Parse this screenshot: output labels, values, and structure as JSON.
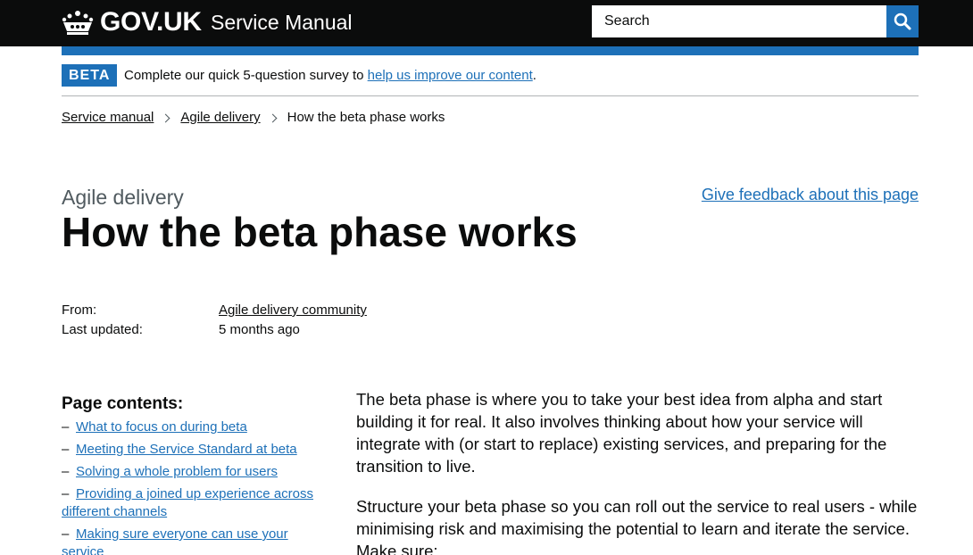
{
  "header": {
    "logo_text": "GOV.UK",
    "service_name": "Service Manual",
    "search_placeholder": "Search",
    "colors": {
      "header_bg": "#0b0c0c",
      "accent_blue": "#1d70b8"
    }
  },
  "phase_banner": {
    "tag": "BETA",
    "text_before": "Complete our quick 5-question survey to ",
    "link_text": "help us improve our content",
    "text_after": "."
  },
  "breadcrumbs": [
    {
      "label": "Service manual"
    },
    {
      "label": "Agile delivery"
    },
    {
      "label": "How the beta phase works"
    }
  ],
  "page": {
    "caption": "Agile delivery",
    "title": "How the beta phase works",
    "feedback_link": "Give feedback about this page"
  },
  "metadata": {
    "from_label": "From:",
    "from_value": "Agile delivery community",
    "updated_label": "Last updated:",
    "updated_value": "5 months ago"
  },
  "contents": {
    "heading": "Page contents:",
    "items": [
      "What to focus on during beta",
      "Meeting the Service Standard at beta",
      "Solving a whole problem for users",
      "Providing a joined up experience across different channels",
      "Making sure everyone can use your service"
    ]
  },
  "body": {
    "paragraphs": [
      "The beta phase is where you to take your best idea from alpha and start building it for real. It also involves thinking about how your service will integrate with (or start to replace) existing services, and preparing for the transition to live.",
      "Structure your beta phase so you can roll out the service to real users - while minimising risk and maximising the potential to learn and iterate the service. Make sure:"
    ]
  }
}
